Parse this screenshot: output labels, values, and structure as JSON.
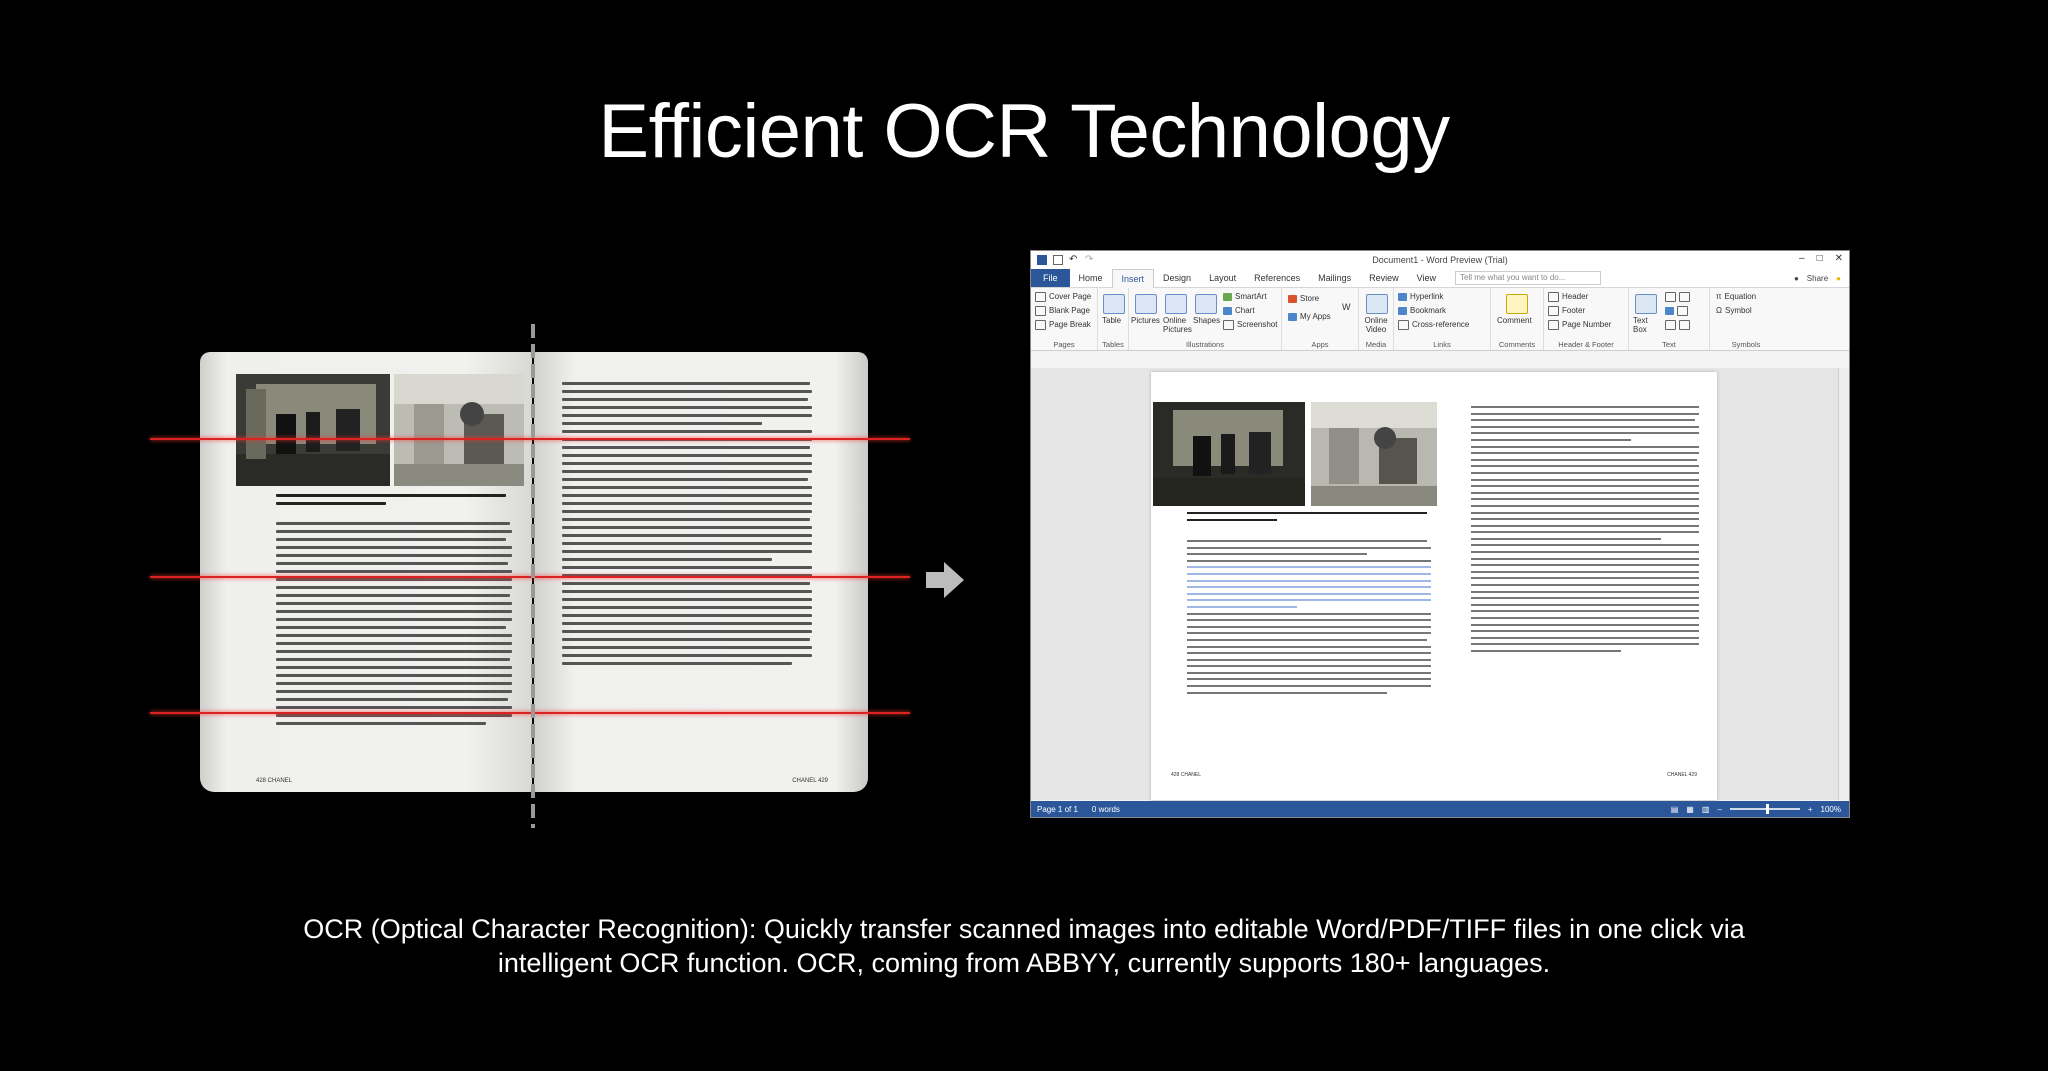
{
  "slide": {
    "title": "Efficient OCR Technology",
    "caption_line1": "OCR (Optical Character Recognition): Quickly transfer scanned images into editable Word/PDF/TIFF files in one click via",
    "caption_line2": "intelligent OCR function. OCR, coming from ABBYY, currently supports 180+ languages."
  },
  "book": {
    "left_footer": "428 CHANEL",
    "right_footer": "CHANEL 429"
  },
  "word": {
    "title": "Document1 - Word Preview (Trial)",
    "tabs": [
      "File",
      "Home",
      "Insert",
      "Design",
      "Layout",
      "References",
      "Mailings",
      "Review",
      "View"
    ],
    "active_tab": "Insert",
    "tell_me_placeholder": "Tell me what you want to do...",
    "share_label": "Share",
    "ribbon": {
      "pages": {
        "label": "Pages",
        "items": [
          "Cover Page",
          "Blank Page",
          "Page Break"
        ]
      },
      "tables": {
        "label": "Tables",
        "items": [
          "Table"
        ]
      },
      "illustrations": {
        "label": "Illustrations",
        "items": [
          "Pictures",
          "Online Pictures",
          "Shapes",
          "SmartArt",
          "Chart",
          "Screenshot"
        ]
      },
      "apps": {
        "label": "Apps",
        "items": [
          "Store",
          "My Apps"
        ]
      },
      "media": {
        "label": "Media",
        "items": [
          "Online Video"
        ]
      },
      "links": {
        "label": "Links",
        "items": [
          "Hyperlink",
          "Bookmark",
          "Cross-reference"
        ]
      },
      "comments": {
        "label": "Comments",
        "items": [
          "Comment"
        ]
      },
      "header_footer": {
        "label": "Header & Footer",
        "items": [
          "Header",
          "Footer",
          "Page Number"
        ]
      },
      "text": {
        "label": "Text",
        "items": [
          "Text Box"
        ]
      },
      "symbols": {
        "label": "Symbols",
        "items": [
          "Equation",
          "Symbol"
        ]
      }
    },
    "page_footer_left": "428 CHANEL",
    "page_footer_right": "CHANEL 429",
    "status": {
      "page": "Page 1 of 1",
      "words": "0 words",
      "zoom": "100%"
    }
  },
  "colors": {
    "word_blue": "#2b579a",
    "scan_red": "#dd2222",
    "background": "#000000"
  },
  "icons": [
    "arrow-right-icon",
    "save-icon",
    "undo-icon",
    "redo-icon",
    "minimize-icon",
    "maximize-icon",
    "close-icon",
    "user-icon",
    "lightbulb-icon"
  ]
}
